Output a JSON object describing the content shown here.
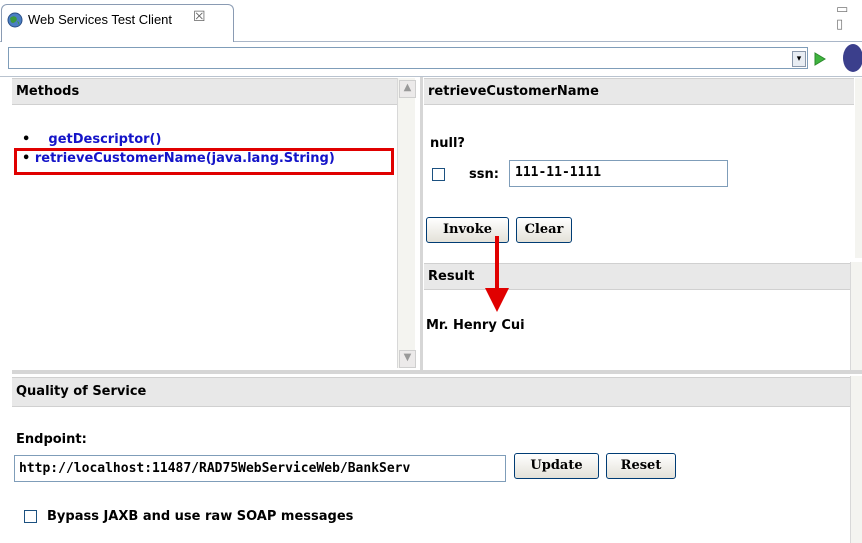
{
  "tab": {
    "title": "Web Services Test Client",
    "close": "☒"
  },
  "window": {
    "minmax": "▭ ▯"
  },
  "urlbar": {
    "value": "",
    "dropdown": "▾"
  },
  "methods": {
    "title": "Methods",
    "items": [
      {
        "bullet": "•",
        "label": "getDescriptor()"
      },
      {
        "bullet": "•",
        "label": "retrieveCustomerName(java.lang.String)"
      }
    ]
  },
  "operation": {
    "title": "retrieveCustomerName",
    "null_label": "null?",
    "ssn_label": "ssn:",
    "ssn_value": "111-11-1111",
    "invoke_label": "Invoke",
    "clear_label": "Clear"
  },
  "result": {
    "title": "Result",
    "value": "Mr. Henry Cui"
  },
  "qos": {
    "title": "Quality of Service",
    "endpoint_label": "Endpoint:",
    "endpoint_value": "http://localhost:11487/RAD75WebServiceWeb/BankServ",
    "update_label": "Update",
    "reset_label": "Reset",
    "bypass_label": "Bypass JAXB and use raw SOAP messages"
  },
  "colors": {
    "highlight": "#e00000",
    "link": "#1414c8"
  }
}
